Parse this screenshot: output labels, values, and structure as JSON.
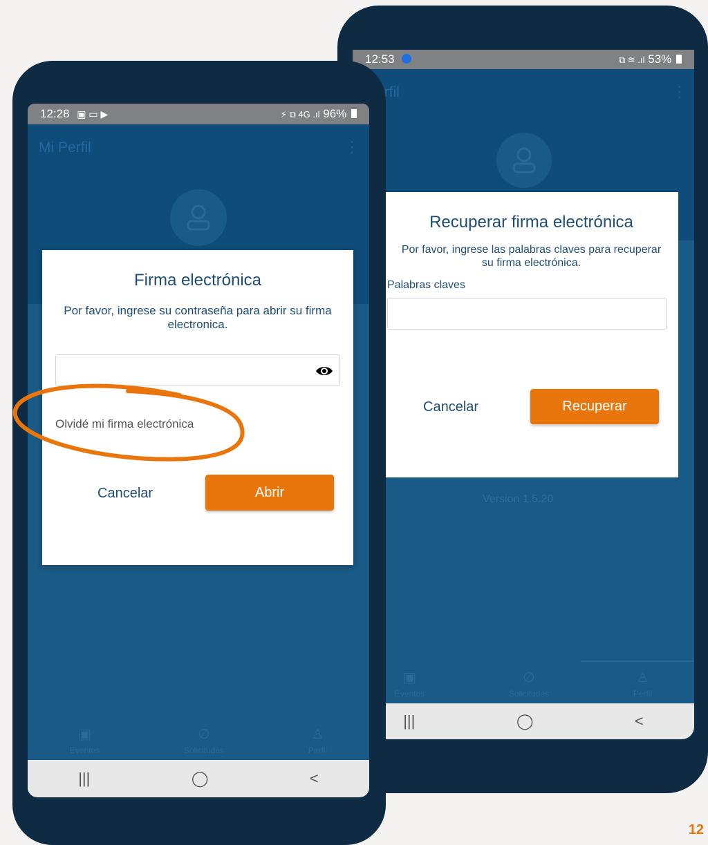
{
  "left_phone": {
    "status": {
      "time": "12:28",
      "right": "96%",
      "left_icons": "▣ ▭ ▶",
      "signal": "⚡ ⧉ 4G .ıl"
    },
    "app_title": "Mi Perfil",
    "dialog": {
      "title": "Firma electrónica",
      "message": "Por favor, ingrese su contraseña para abrir su firma electronica.",
      "password_value": "",
      "forgot_link": "Olvidé mi firma electrónica",
      "cancel_label": "Cancelar",
      "open_label": "Abrir"
    },
    "bottom_tabs": [
      "Eventos",
      "Solicitudes",
      "Perfil"
    ],
    "nav": {
      "recents": "|||",
      "home": "◯",
      "back": "<"
    }
  },
  "right_phone": {
    "status": {
      "time": "12:53",
      "right": "53%",
      "signal": "⧉ ≋ .ıl"
    },
    "app_title": "Perfil",
    "version": "Version 1.5.20",
    "dialog": {
      "title": "Recuperar firma electrónica",
      "message": "Por favor, ingrese las palabras claves para recuperar su firma electrónica.",
      "field_label": "Palabras claves",
      "field_value": "",
      "cancel_label": "Cancelar",
      "recover_label": "Recuperar"
    },
    "bottom_tabs": [
      "Eventos",
      "Solicitudes",
      "Perfil"
    ],
    "nav": {
      "recents": "|||",
      "home": "◯",
      "back": "<"
    }
  },
  "page_number": "12",
  "colors": {
    "accent": "#e8760d",
    "primary": "#0f4c7a",
    "title_text": "#1e4d75"
  }
}
